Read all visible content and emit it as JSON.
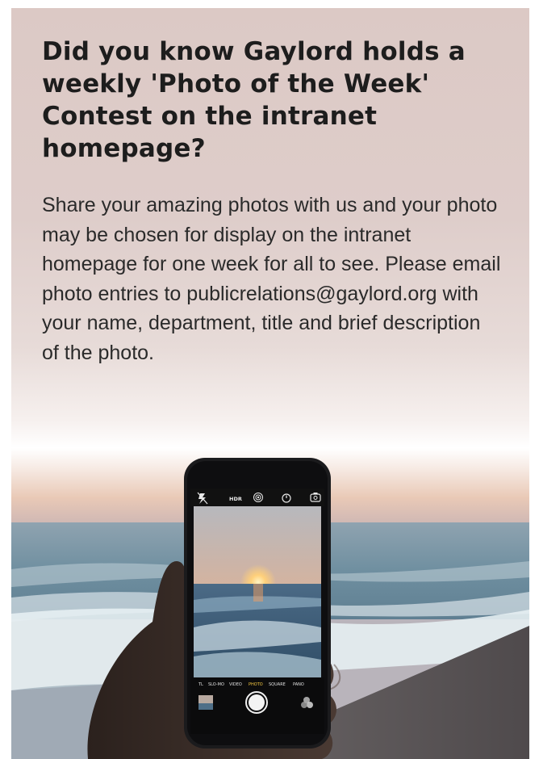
{
  "card": {
    "headline": "Did you know Gaylord holds a weekly 'Photo of the Week' Contest on the intranet homepage?",
    "body": "Share your amazing photos with us and your photo may be chosen for display on the intranet homepage for one week for all to see. Please email photo entries to publicrelations@gaylord.org with your name, department, title and brief description of the photo."
  },
  "photo": {
    "camera_top_labels": [
      "HDR"
    ],
    "camera_modes": [
      "TL",
      "SLO-MO",
      "VIDEO",
      "PHOTO",
      "SQUARE",
      "PANO"
    ],
    "active_mode": "PHOTO",
    "icons": [
      "flash-off-icon",
      "live-photo-icon",
      "timer-icon",
      "flip-camera-icon",
      "shutter-button-icon",
      "filters-icon",
      "thumbnail"
    ],
    "colors": {
      "background": "#dcc9c5",
      "headline": "#1d1d1d",
      "body": "#2a2a2a",
      "active_mode": "#f5c842"
    }
  }
}
